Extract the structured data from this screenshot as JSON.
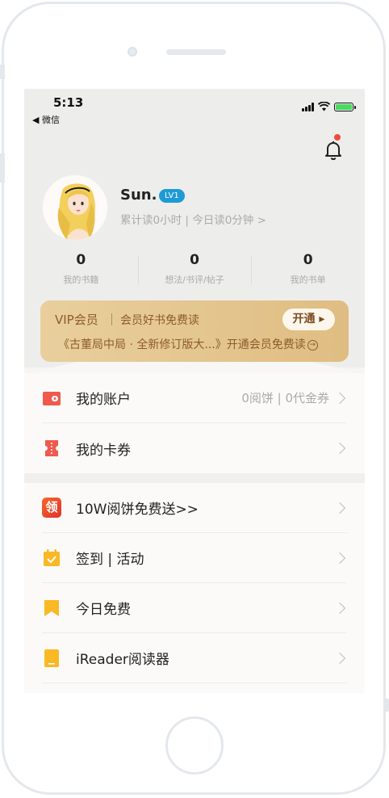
{
  "status": {
    "time": "5:13",
    "back_app": "◀ 微信"
  },
  "profile": {
    "name": "Sun.",
    "level": "LV1",
    "reading_stats": "累计读0小时 | 今日读0分钟 >"
  },
  "stats": [
    {
      "value": "0",
      "label": "我的书籍"
    },
    {
      "value": "0",
      "label": "想法/书评/帖子"
    },
    {
      "value": "0",
      "label": "我的书单"
    }
  ],
  "vip": {
    "title": "VIP会员",
    "subtitle": "会员好书免费读",
    "button": "开通 ▸",
    "promo": "《古董局中局 · 全新修订版大...》开通会员免费读"
  },
  "menu_group_1": [
    {
      "label": "我的账户",
      "right": "0阅饼 | 0代金券",
      "icon": "wallet-icon"
    },
    {
      "label": "我的卡券",
      "right": "",
      "icon": "ticket-icon"
    }
  ],
  "menu_group_2": [
    {
      "label": "10W阅饼免费送>>",
      "icon": "gift-icon",
      "icon_text": "领"
    },
    {
      "label": "签到 | 活动",
      "icon": "calendar-check-icon"
    },
    {
      "label": "今日免费",
      "icon": "bookmark-icon"
    },
    {
      "label": "iReader阅读器",
      "icon": "ereader-icon"
    }
  ],
  "colors": {
    "level_badge": "#1e9bd7",
    "vip_gold": "#dfbd82",
    "vip_text": "#8d5c2a",
    "wallet_red": "#ef5a4d",
    "orange": "#f9b824",
    "notification_dot": "#f24a3c"
  }
}
